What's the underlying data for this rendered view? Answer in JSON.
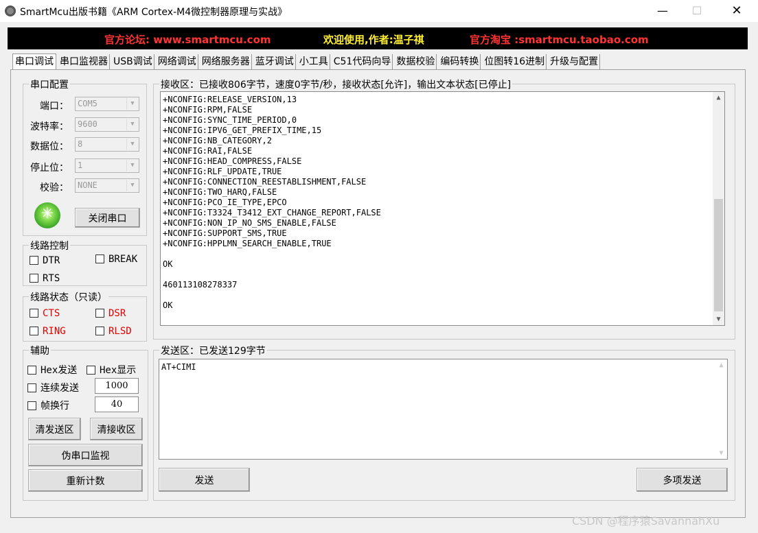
{
  "window": {
    "title": "SmartMcu出版书籍《ARM Cortex-M4微控制器原理与实战》",
    "min_glyph": "—",
    "max_glyph": "☐",
    "close_glyph": "✕"
  },
  "banner": {
    "forum": "官方论坛: www.smartmcu.com",
    "welcome": "欢迎使用,作者:温子祺",
    "shop": "官方淘宝 :smartmcu.taobao.com",
    "colors": {
      "forum": "#ff3333",
      "welcome": "#ffee33",
      "shop": "#ff3333"
    }
  },
  "tabs": [
    "串口调试",
    "串口监视器",
    "USB调试",
    "网络调试",
    "网络服务器",
    "蓝牙调试",
    "小工具",
    "C51代码向导",
    "数据校验",
    "编码转换",
    "位图转16进制",
    "升级与配置"
  ],
  "serial_config": {
    "title": "串口配置",
    "port_label": "端口：",
    "port_value": "COM5",
    "baud_label": "波特率：",
    "baud_value": "9600",
    "databits_label": "数据位：",
    "databits_value": "8",
    "stopbits_label": "停止位：",
    "stopbits_value": "1",
    "parity_label": "校验：",
    "parity_value": "NONE",
    "close_button": "关闭串口",
    "status_led": "port-open-indicator-icon"
  },
  "line_control": {
    "title": "线路控制",
    "dtr": "DTR",
    "break": "BREAK",
    "rts": "RTS"
  },
  "line_status": {
    "title": "线路状态（只读）",
    "cts": "CTS",
    "dsr": "DSR",
    "ring": "RING",
    "rlsd": "RLSD"
  },
  "aux": {
    "title": "辅助",
    "hex_send": "Hex发送",
    "hex_display": "Hex显示",
    "continuous_send": "连续发送",
    "continuous_interval": "1000",
    "frame_newline": "帧换行",
    "frame_value": "40",
    "clear_send": "清发送区",
    "clear_receive": "清接收区",
    "fake_monitor": "伪串口监视",
    "recount": "重新计数"
  },
  "receive": {
    "header": "接收区：已接收806字节，速度0字节/秒，接收状态[允许]，输出文本状态[已停止]",
    "lines": [
      "+NCONFIG:RELEASE_VERSION,13",
      "+NCONFIG:RPM,FALSE",
      "+NCONFIG:SYNC_TIME_PERIOD,0",
      "+NCONFIG:IPV6_GET_PREFIX_TIME,15",
      "+NCONFIG:NB_CATEGORY,2",
      "+NCONFIG:RAI,FALSE",
      "+NCONFIG:HEAD_COMPRESS,FALSE",
      "+NCONFIG:RLF_UPDATE,TRUE",
      "+NCONFIG:CONNECTION_REESTABLISHMENT,FALSE",
      "+NCONFIG:TWO_HARQ,FALSE",
      "+NCONFIG:PCO_IE_TYPE,EPCO",
      "+NCONFIG:T3324_T3412_EXT_CHANGE_REPORT,FALSE",
      "+NCONFIG:NON_IP_NO_SMS_ENABLE,FALSE",
      "+NCONFIG:SUPPORT_SMS,TRUE",
      "+NCONFIG:HPPLMN_SEARCH_ENABLE,TRUE",
      "",
      "OK",
      "",
      "460113108278337",
      "",
      "OK"
    ]
  },
  "send": {
    "header": "发送区：已发送129字节",
    "content": "AT+CIMI",
    "send_button": "发送",
    "multi_send_button": "多项发送"
  },
  "scroll": {
    "up_glyph": "▲",
    "down_glyph": "▼",
    "combo_glyph": "▼"
  },
  "watermark": "CSDN @程序猿SavannahXu"
}
